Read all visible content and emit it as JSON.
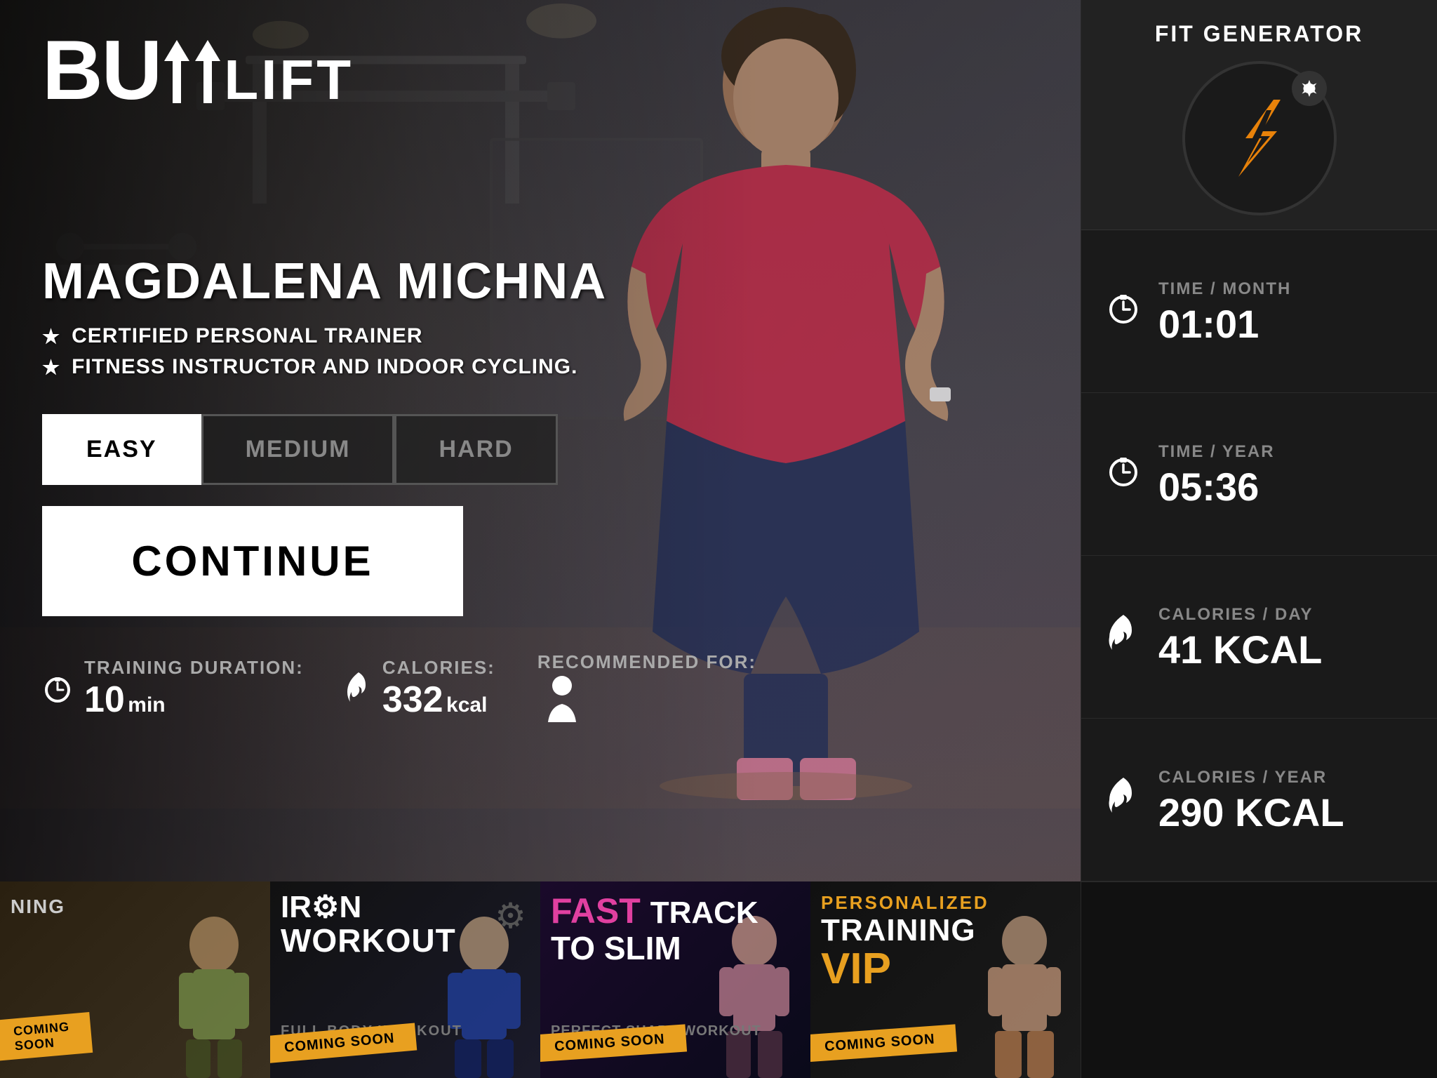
{
  "app": {
    "logo": {
      "butt": "BUTT",
      "lift": "LIFT"
    },
    "fit_generator_title": "FIT GENERATOR"
  },
  "trainer": {
    "name": "MAGDALENA MICHNA",
    "bullet1": "CERTIFIED PERSONAL TRAINER",
    "bullet2": "FITNESS INSTRUCTOR AND INDOOR CYCLING."
  },
  "difficulty": {
    "options": [
      "EASY",
      "MEDIUM",
      "HARD"
    ],
    "selected": "EASY"
  },
  "continue_label": "CONTINUE",
  "training_info": {
    "duration_label": "TRAINING DURATION:",
    "duration_value": "10",
    "duration_unit": "min",
    "calories_label": "CALORIES:",
    "calories_value": "332",
    "calories_unit": "kcal",
    "recommended_label": "RECOMMENDED FOR:"
  },
  "sidebar": {
    "stats": [
      {
        "label": "TIME / MONTH",
        "value": "01:01",
        "icon": "timer"
      },
      {
        "label": "TIME / YEAR",
        "value": "05:36",
        "icon": "timer"
      },
      {
        "label": "CALORIES / DAY",
        "value": "41 KCAL",
        "icon": "flame"
      },
      {
        "label": "CALORIES / YEAR",
        "value": "290 KCAL",
        "icon": "flame"
      }
    ]
  },
  "banners": [
    {
      "id": "iron-workout",
      "title_line1": "IRON",
      "title_line2": "WORKOUT",
      "subtitle": "FULL BODY WORKOUT",
      "coming_soon": "COMING SOON",
      "has_gear": true
    },
    {
      "id": "fast-track",
      "title_pre": "FAST",
      "title_main": "TRACK",
      "title_line2": "TO SLIM",
      "subtitle": "PERFECT SHAPE WORKOUT",
      "coming_soon": "COMING SOON"
    },
    {
      "id": "vip-training",
      "title_line1": "PERSONALIZED",
      "title_line2": "TRAINING",
      "title_vip": "VIP",
      "coming_soon": "COMING SOON"
    }
  ]
}
